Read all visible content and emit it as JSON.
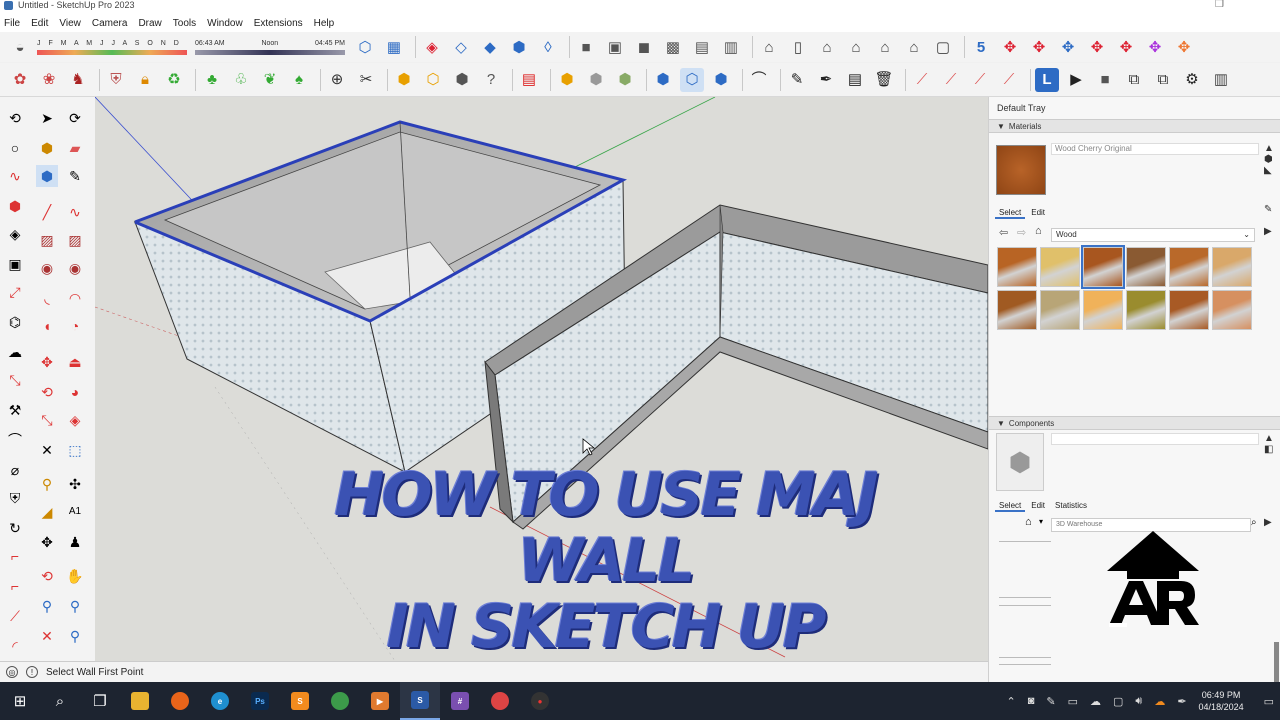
{
  "window": {
    "title": "Untitled - SketchUp Pro 2023"
  },
  "menu": [
    "File",
    "Edit",
    "View",
    "Camera",
    "Draw",
    "Tools",
    "Window",
    "Extensions",
    "Help"
  ],
  "shadow": {
    "months": "J F M A M J J A S O N D",
    "time_start": "06:43 AM",
    "time_mid": "Noon",
    "time_end": "04:45 PM"
  },
  "viewport": {
    "overlay_line1": "HOW TO USE MAJ WALL",
    "overlay_line2": "IN SKETCH UP"
  },
  "tray": {
    "title": "Default Tray",
    "materials": {
      "header": "Materials",
      "material_name": "Wood Cherry Original",
      "tab_select": "Select",
      "tab_edit": "Edit",
      "library": "Wood",
      "swatches": [
        "#b86424",
        "#e0c06a",
        "#a8561f",
        "#8a5a32",
        "#b9692a",
        "#d9a86a",
        "#a05a22",
        "#b8a577",
        "#f0b25a",
        "#9a8c2e",
        "#a85a25",
        "#d69060"
      ],
      "selected_index": 2
    },
    "components": {
      "header": "Components",
      "tab_select": "Select",
      "tab_edit": "Edit",
      "tab_statistics": "Statistics",
      "search_placeholder": "3D Warehouse"
    }
  },
  "status": {
    "text": "Select Wall First Point"
  },
  "taskbar": {
    "time": "06:49 PM",
    "date": "04/18/2024"
  },
  "colors": {
    "accent": "#3a72c7",
    "title_overlay": "#3b52b3",
    "wall_selected_edge": "#2a3fb8"
  }
}
